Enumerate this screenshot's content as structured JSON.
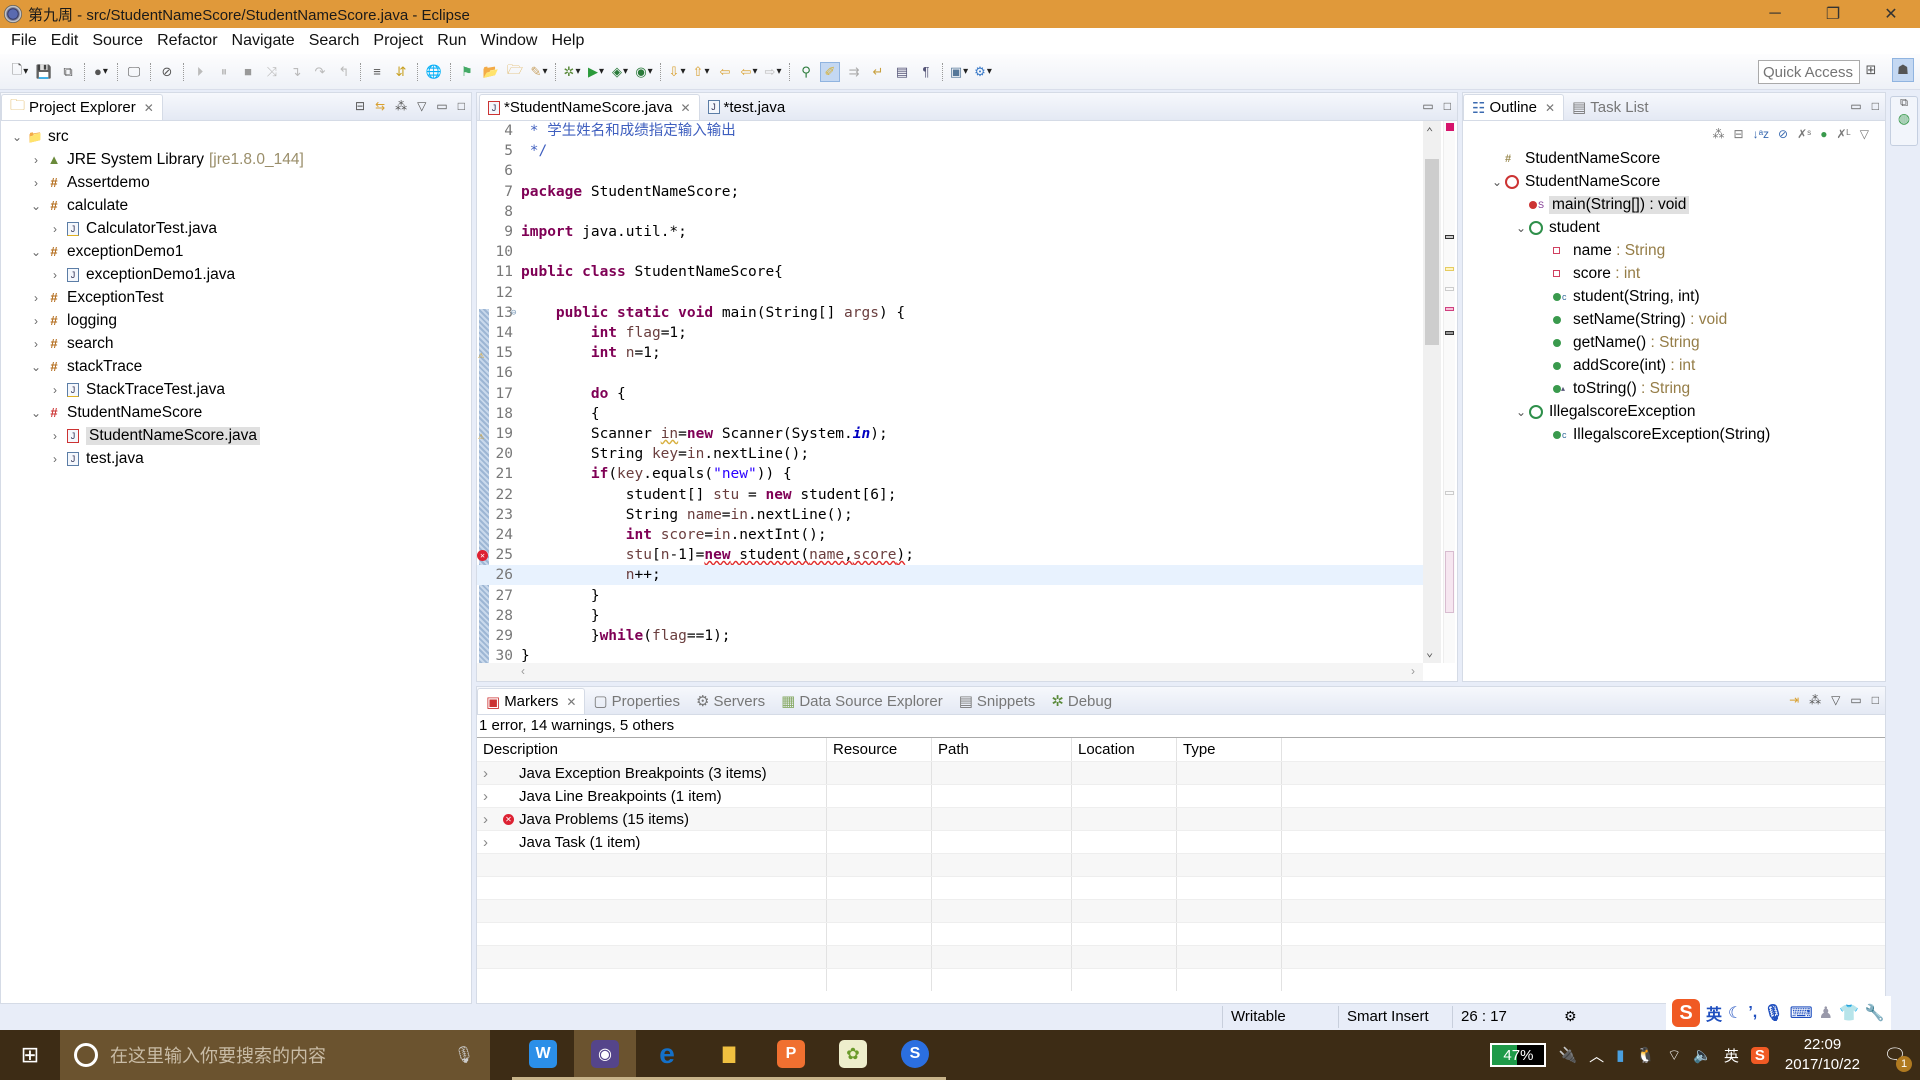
{
  "window": {
    "title": "第九周 - src/StudentNameScore/StudentNameScore.java - Eclipse",
    "controls": [
      "minimize",
      "restore",
      "close"
    ]
  },
  "menu": [
    "File",
    "Edit",
    "Source",
    "Refactor",
    "Navigate",
    "Search",
    "Project",
    "Run",
    "Window",
    "Help"
  ],
  "toolbar": {
    "quick_access_placeholder": "Quick Access"
  },
  "project_explorer": {
    "tab_label": "Project Explorer",
    "tree": [
      {
        "label": "src",
        "depth": 0,
        "expanded": true,
        "icon": "source-folder-error-icon"
      },
      {
        "label": "JRE System Library",
        "decoration": "[jre1.8.0_144]",
        "depth": 1,
        "expanded": false,
        "icon": "library-icon"
      },
      {
        "label": "Assertdemo",
        "depth": 1,
        "expanded": false,
        "icon": "package-icon"
      },
      {
        "label": "calculate",
        "depth": 1,
        "expanded": true,
        "icon": "package-warning-icon"
      },
      {
        "label": "CalculatorTest.java",
        "depth": 2,
        "expanded": false,
        "icon": "java-file-warning-icon"
      },
      {
        "label": "exceptionDemo1",
        "depth": 1,
        "expanded": true,
        "icon": "package-icon"
      },
      {
        "label": "exceptionDemo1.java",
        "depth": 2,
        "expanded": false,
        "icon": "java-file-icon"
      },
      {
        "label": "ExceptionTest",
        "depth": 1,
        "expanded": false,
        "icon": "package-warning-icon"
      },
      {
        "label": "logging",
        "depth": 1,
        "expanded": false,
        "icon": "package-warning-icon"
      },
      {
        "label": "search",
        "depth": 1,
        "expanded": false,
        "icon": "package-warning-icon"
      },
      {
        "label": "stackTrace",
        "depth": 1,
        "expanded": true,
        "icon": "package-warning-icon"
      },
      {
        "label": "StackTraceTest.java",
        "depth": 2,
        "expanded": false,
        "icon": "java-file-warning-icon"
      },
      {
        "label": "StudentNameScore",
        "depth": 1,
        "expanded": true,
        "icon": "package-error-icon"
      },
      {
        "label": "StudentNameScore.java",
        "depth": 2,
        "expanded": false,
        "icon": "java-file-error-icon",
        "selected": true
      },
      {
        "label": "test.java",
        "depth": 2,
        "expanded": false,
        "icon": "java-file-icon"
      }
    ]
  },
  "editor": {
    "tabs": [
      {
        "label": "*StudentNameScore.java",
        "active": true,
        "closable": true
      },
      {
        "label": "*test.java",
        "active": false
      }
    ],
    "current_line": 26,
    "lines": [
      {
        "n": "4",
        "html": "<span class='cm'> * 学生姓名和成绩指定输入输出</span>"
      },
      {
        "n": "5",
        "html": "<span class='cm'> */</span>"
      },
      {
        "n": "6",
        "html": ""
      },
      {
        "n": "7",
        "html": "<span class='kw'>package</span> StudentNameScore;"
      },
      {
        "n": "8",
        "html": ""
      },
      {
        "n": "9",
        "html": "<span class='kw'>import</span> java.util.*;"
      },
      {
        "n": "10",
        "html": ""
      },
      {
        "n": "11",
        "html": "<span class='kw'>public</span> <span class='kw'>class</span> StudentNameScore{"
      },
      {
        "n": "12",
        "html": ""
      },
      {
        "n": "13",
        "html": "    <span class='kw'>public</span> <span class='kw'>static</span> <span class='kw'>void</span> main(String[] <span class='var'>args</span>) {"
      },
      {
        "n": "14",
        "html": "        <span class='kw'>int</span> <span class='var'>flag</span>=1;"
      },
      {
        "n": "15",
        "html": "        <span class='kw'>int</span> <span class='var'>n</span>=1;"
      },
      {
        "n": "16",
        "html": ""
      },
      {
        "n": "17",
        "html": "        <span class='kw'>do</span> {"
      },
      {
        "n": "18",
        "html": "        {"
      },
      {
        "n": "19",
        "html": "        Scanner <span class='var warn'>in</span>=<span class='kw'>new</span> Scanner(System.<span class='fld'>in</span>);"
      },
      {
        "n": "20",
        "html": "        String <span class='var'>key</span>=<span class='var'>in</span>.nextLine();"
      },
      {
        "n": "21",
        "html": "        <span class='kw'>if</span>(<span class='var'>key</span>.equals(<span class='str'>\"new\"</span>)) {"
      },
      {
        "n": "22",
        "html": "            student[] <span class='var'>stu</span> = <span class='kw'>new</span> student[6];"
      },
      {
        "n": "23",
        "html": "            String <span class='var'>name</span>=<span class='var'>in</span>.nextLine();"
      },
      {
        "n": "24",
        "html": "            <span class='kw'>int</span> <span class='var'>score</span>=<span class='var'>in</span>.nextInt();"
      },
      {
        "n": "25",
        "html": "            <span class='var'>stu</span>[<span class='var'>n</span>-1]=<span class='err'><span class='kw'>new</span> student(<span class='var'>name</span>,<span class='var'>score</span>)</span>;"
      },
      {
        "n": "26",
        "html": "            <span class='var'>n</span>++;"
      },
      {
        "n": "27",
        "html": "        }"
      },
      {
        "n": "28",
        "html": "        }"
      },
      {
        "n": "29",
        "html": "        }<span class='kw'>while</span>(<span class='var'>flag</span>==1);"
      },
      {
        "n": "30",
        "html": "}"
      }
    ]
  },
  "outline": {
    "tabs": [
      {
        "label": "Outline",
        "active": true
      },
      {
        "label": "Task List",
        "active": false
      }
    ],
    "items": [
      {
        "label": "StudentNameScore",
        "type": "",
        "depth": 0,
        "twisty": "",
        "icon": "package-icon"
      },
      {
        "label": "StudentNameScore",
        "type": "",
        "depth": 0,
        "twisty": "expanded",
        "icon": "class-error-icon"
      },
      {
        "label": "main(String[]) : void",
        "type": "",
        "depth": 1,
        "twisty": "",
        "icon": "static-method-error-icon",
        "selected": true
      },
      {
        "label": "student",
        "type": "",
        "depth": 1,
        "twisty": "expanded",
        "icon": "class-default-icon"
      },
      {
        "label": "name",
        "type": " : String",
        "depth": 2,
        "twisty": "",
        "icon": "private-field-icon"
      },
      {
        "label": "score",
        "type": " : int",
        "depth": 2,
        "twisty": "",
        "icon": "private-field-icon"
      },
      {
        "label": "student(String, int)",
        "type": "",
        "depth": 2,
        "twisty": "",
        "icon": "constructor-icon"
      },
      {
        "label": "setName(String)",
        "type": " : void",
        "depth": 2,
        "twisty": "",
        "icon": "public-method-icon"
      },
      {
        "label": "getName()",
        "type": " : String",
        "depth": 2,
        "twisty": "",
        "icon": "public-method-icon"
      },
      {
        "label": "addScore(int)",
        "type": " : int",
        "depth": 2,
        "twisty": "",
        "icon": "public-method-icon"
      },
      {
        "label": "toString()",
        "type": " : String",
        "depth": 2,
        "twisty": "",
        "icon": "override-method-icon"
      },
      {
        "label": "IllegalscoreException",
        "type": "",
        "depth": 1,
        "twisty": "expanded",
        "icon": "class-default-icon"
      },
      {
        "label": "IllegalscoreException(String)",
        "type": "",
        "depth": 2,
        "twisty": "",
        "icon": "constructor-icon"
      }
    ]
  },
  "markers": {
    "tabs": [
      "Markers",
      "Properties",
      "Servers",
      "Data Source Explorer",
      "Snippets",
      "Debug"
    ],
    "summary": "1 error, 14 warnings, 5 others",
    "columns": [
      "Description",
      "Resource",
      "Path",
      "Location",
      "Type"
    ],
    "rows": [
      {
        "description": "Java Exception Breakpoints (3 items)",
        "error": false
      },
      {
        "description": "Java Line Breakpoints (1 item)",
        "error": false
      },
      {
        "description": "Java Problems (15 items)",
        "error": true
      },
      {
        "description": "Java Task (1 item)",
        "error": false
      }
    ]
  },
  "statusbar": {
    "writable": "Writable",
    "insert_mode": "Smart Insert",
    "position": "26 : 17"
  },
  "ime_bar": {
    "lang": "英"
  },
  "taskbar": {
    "search_placeholder": "在这里输入你要搜索的内容",
    "apps": [
      {
        "name": "wps-writer",
        "glyph": "W",
        "color": "#2b8fe8"
      },
      {
        "name": "eclipse",
        "glyph": "◉",
        "color": "#55458a",
        "active": true
      },
      {
        "name": "edge",
        "glyph": "e",
        "color": "#1470c8"
      },
      {
        "name": "file-explorer",
        "glyph": "▇",
        "color": "#f0c040"
      },
      {
        "name": "wps-presentation",
        "glyph": "P",
        "color": "#f07030"
      },
      {
        "name": "app-duck",
        "glyph": "✿",
        "color": "#eeeecc"
      },
      {
        "name": "sogou-browser",
        "glyph": "S",
        "color": "#2b6fe0"
      }
    ],
    "battery_percent": 47,
    "battery_label": "47%",
    "ime": "英",
    "time": "22:09",
    "date": "2017/10/22",
    "notifications": "1"
  }
}
